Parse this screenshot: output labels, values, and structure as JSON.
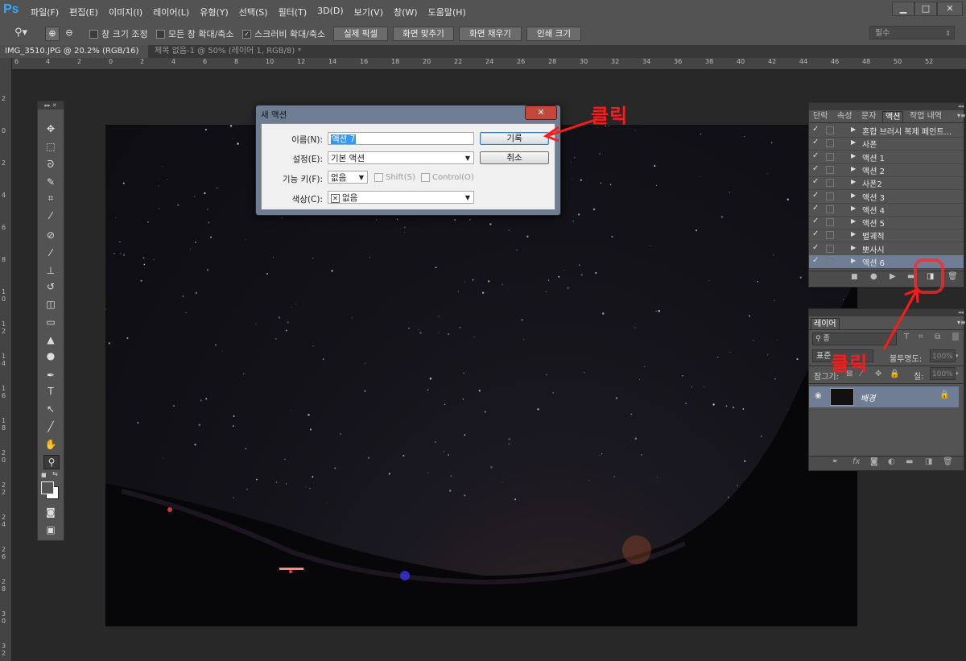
{
  "app": {
    "logo": "Ps",
    "menu": [
      "파일(F)",
      "편집(E)",
      "이미지(I)",
      "레이어(L)",
      "유형(Y)",
      "선택(S)",
      "필터(T)",
      "3D(D)",
      "보기(V)",
      "창(W)",
      "도움말(H)"
    ],
    "window_controls": [
      "▁",
      "□",
      "✕"
    ]
  },
  "options_bar": {
    "checks": [
      {
        "label": "창 크기 조정",
        "checked": false
      },
      {
        "label": "모든 창 확대/축소",
        "checked": false
      },
      {
        "label": "스크러비 확대/축소",
        "checked": true
      }
    ],
    "buttons": [
      "실제 픽셀",
      "화면 맞추기",
      "화면 채우기",
      "인쇄 크기"
    ],
    "workspace": "필수"
  },
  "tabs": [
    {
      "label": "IMG_3510.JPG @ 20.2% (RGB/16) *",
      "active": true
    },
    {
      "label": "제목 없음-1 @ 50% (레이어 1, RGB/8) *",
      "active": false
    }
  ],
  "ruler": {
    "top": [
      "6",
      "4",
      "2",
      "0",
      "2",
      "4",
      "6",
      "8",
      "10",
      "12",
      "14",
      "16",
      "18",
      "20",
      "22",
      "24",
      "26",
      "28",
      "30",
      "32",
      "34",
      "36",
      "38",
      "40",
      "42",
      "44",
      "46",
      "48",
      "50",
      "52"
    ],
    "left": [
      "2",
      "0",
      "2",
      "4",
      "6",
      "8",
      "1 0",
      "1 2",
      "1 4",
      "1 6",
      "1 8",
      "2 0",
      "2 2",
      "2 4",
      "2 6",
      "2 8",
      "3 0",
      "3 2"
    ]
  },
  "dialog": {
    "title": "새 액션",
    "name_label": "이름(N):",
    "name_value": "액션 7",
    "set_label": "설정(E):",
    "set_value": "기본 액션",
    "fkey_label": "기능 키(F):",
    "fkey_value": "없음",
    "shift_label": "Shift(S)",
    "control_label": "Control(O)",
    "color_label": "색상(C):",
    "color_value": "없음",
    "record_button": "기록",
    "cancel_button": "취소"
  },
  "actions_panel": {
    "tabs": [
      "단락",
      "속성",
      "문자",
      "액션",
      "작업 내역"
    ],
    "active_tab": "액션",
    "items": [
      "혼합 브러시 복제 페인트...",
      "사폰",
      "액션 1",
      "액션 2",
      "사폰2",
      "액션 3",
      "액션 4",
      "액션 5",
      "별궤적",
      "뽀사시",
      "액션 6"
    ]
  },
  "layers_panel": {
    "tab": "레이어",
    "kind_placeholder": "종",
    "blend_mode": "표준",
    "opacity_label": "불투명도:",
    "opacity_value": "100%",
    "lock_label": "잠그기:",
    "fill_label": "칠:",
    "fill_value": "100%",
    "layer_name": "배경"
  },
  "annotations": {
    "click1": "클릭",
    "click2": "클릭"
  },
  "colors": {
    "annotation": "#ff1a1a",
    "ps_blue": "#31a8ff"
  }
}
